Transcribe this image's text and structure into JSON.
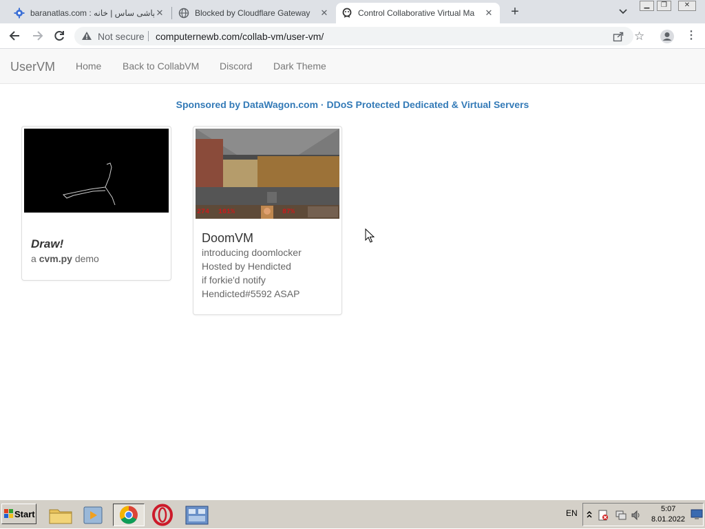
{
  "browser": {
    "tabs": [
      {
        "title": "baranatlas.com : سمپاشی ساس | خانه",
        "active": false
      },
      {
        "title": "Blocked by Cloudflare Gateway",
        "active": false
      },
      {
        "title": "Control Collaborative Virtual Ma",
        "active": true
      }
    ],
    "new_tab_label": "+",
    "address": {
      "security_label": "Not secure",
      "url": "computernewb.com/collab-vm/user-vm/"
    }
  },
  "site": {
    "brand": "UserVM",
    "nav": [
      {
        "label": "Home"
      },
      {
        "label": "Back to CollabVM"
      },
      {
        "label": "Discord"
      },
      {
        "label": "Dark Theme"
      }
    ],
    "sponsor": "Sponsored by DataWagon.com · DDoS Protected Dedicated & Virtual Servers",
    "vms": [
      {
        "title": "Draw!",
        "line_prefix": "a ",
        "line_bold": "cvm.py",
        "line_suffix": " demo"
      },
      {
        "title": "DoomVM",
        "lines": [
          "introducing doomlocker",
          "Hosted by Hendicted",
          "if forkie'd notify",
          "Hendicted#5592 ASAP"
        ],
        "hud": {
          "ammo": "274",
          "health": "161%",
          "armor": "87%"
        }
      }
    ]
  },
  "taskbar": {
    "start_label": "Start",
    "language": "EN",
    "time": "5:07",
    "date": "8.01.2022"
  },
  "colors": {
    "link": "#337ab7",
    "tabstrip": "#dee1e6",
    "taskbar": "#d4d0c8"
  },
  "icons": [
    "gear-icon",
    "globe-icon",
    "collabvm-icon",
    "close-icon",
    "warning-icon",
    "share-icon",
    "star-icon",
    "profile-icon",
    "menu-icon",
    "folder-icon",
    "media-icon",
    "chrome-icon",
    "opera-icon",
    "control-panel-icon"
  ]
}
